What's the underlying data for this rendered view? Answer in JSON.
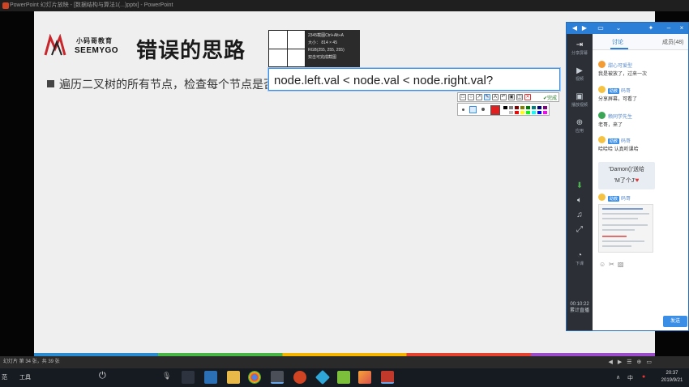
{
  "window": {
    "title": "PowerPoint 幻灯片放映 - [数据结构与算法1(...)pptx] - PowerPoint"
  },
  "slide": {
    "logo_cn": "小码哥教育",
    "logo_en": "SEEMYGO",
    "title": "错误的思路",
    "bullet": "遍历二叉树的所有节点，检查每个节点是否满足：node.left.val < node.val < node.right.val?"
  },
  "snip_tool": {
    "info_lines": [
      "2345截图Ctrl+Alt+A",
      "大小： 814 × 45",
      "RGB(255, 255, 255)",
      "双击可完成截图"
    ],
    "highlight_text": "node.left.val < node.val < node.right.val?",
    "done_label": "✔完成",
    "palette": [
      "#000000",
      "#808080",
      "#800000",
      "#808000",
      "#008000",
      "#008080",
      "#000080",
      "#800080",
      "#ffffff",
      "#c0c0c0",
      "#ff0000",
      "#ffff00",
      "#00ff00",
      "#00ffff",
      "#0000ff",
      "#ff00ff"
    ],
    "current_color": "#e02020"
  },
  "chat": {
    "sidebar": [
      {
        "icon": "share-icon",
        "label": "分享屏幕"
      },
      {
        "icon": "video-icon",
        "label": "视频"
      },
      {
        "icon": "screen-icon",
        "label": "播放视频"
      },
      {
        "icon": "apps-icon",
        "label": "应用"
      },
      {
        "icon": "timer-icon",
        "label": "下课"
      }
    ],
    "time": "00:10:22",
    "time_label": "累计直播",
    "tab_discuss": "讨论",
    "tab_members": "成员(48)",
    "messages": [
      {
        "name": "甜心可爱型",
        "tag": "",
        "text": "我是被放了，过来一次"
      },
      {
        "name": "码哥",
        "tag": "助教",
        "text": "分享屏幕，可看了"
      },
      {
        "name": "赖同学先生",
        "tag": "",
        "text": "老哥，来了"
      },
      {
        "name": "码哥",
        "tag": "助教",
        "text": "哈哈哈 认真听课哈"
      }
    ],
    "gift_line1": "'Damon()'送给",
    "gift_line2": "'M了个J'",
    "last_sender": "码哥",
    "last_tag": "助教",
    "send_label": "发送"
  },
  "statusbar": {
    "text": "幻灯片 第 34 张，共 39 张"
  },
  "taskbar": {
    "left_text": "范",
    "tools_text": "工具",
    "ime": "中",
    "time": "20:37",
    "date": "2019/9/21"
  }
}
